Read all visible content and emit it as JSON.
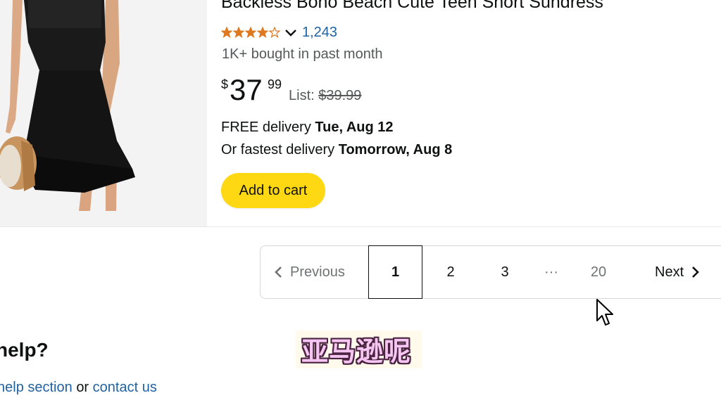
{
  "product": {
    "title": "Backless Boho Beach Cute Teen Short Sundress",
    "rating_value": 4.2,
    "review_count": "1,243",
    "bought_text": "1K+ bought in past month",
    "price_symbol": "$",
    "price_whole": "37",
    "price_fraction": "99",
    "list_label": "List:",
    "list_price": "$39.99",
    "delivery_free_prefix": "FREE delivery",
    "delivery_free_date": "Tue, Aug 12",
    "delivery_fast_prefix": "Or fastest delivery",
    "delivery_fast_date": "Tomorrow, Aug 8",
    "add_to_cart": "Add to cart"
  },
  "pagination": {
    "previous": "Previous",
    "pages": [
      "1",
      "2",
      "3"
    ],
    "current_page": "1",
    "ellipsis": "···",
    "last_page": "20",
    "next": "Next"
  },
  "help": {
    "heading": "help?",
    "link_section": "help section",
    "or_text": "or",
    "link_contact": "contact us"
  },
  "caption": "亚马逊呢",
  "colors": {
    "link": "#2162a1",
    "cart_button": "#ffd814",
    "star": "#de7921",
    "caption_fill": "#f4c6f1"
  }
}
